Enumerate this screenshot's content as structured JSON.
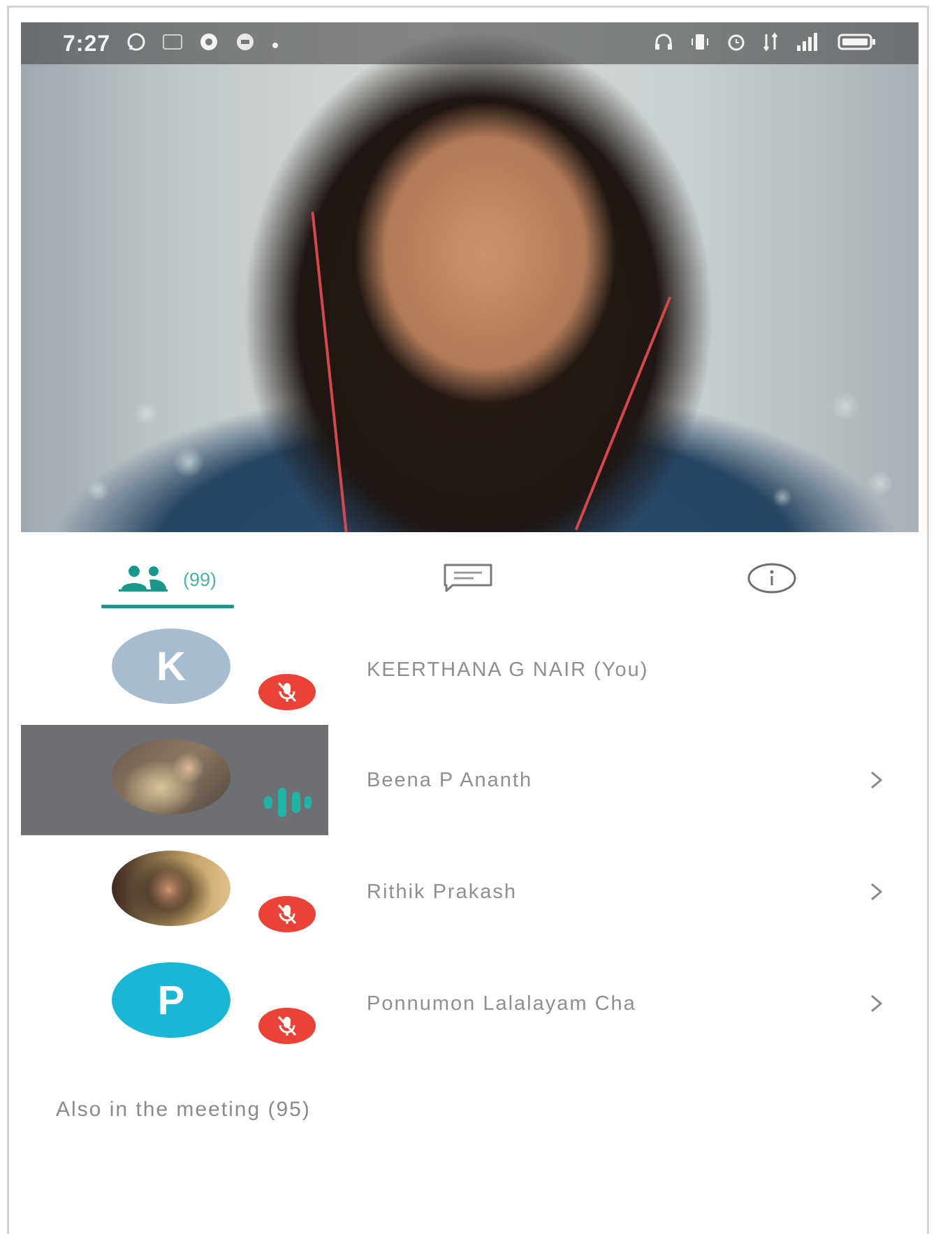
{
  "status_bar": {
    "time": "7:27",
    "left_icons": [
      "whatsapp-icon",
      "notification-icon",
      "record-icon",
      "app-icon",
      "dot-icon"
    ],
    "right_icons": [
      "headset-icon",
      "vibrate-icon",
      "alarm-icon",
      "data-icon",
      "signal-icon",
      "battery-icon"
    ]
  },
  "tabs": {
    "people_count": "(99)",
    "active": "people"
  },
  "colors": {
    "accent": "#17988a",
    "muted_badge": "#ea4335",
    "speaking": "#1fb5a5",
    "avatar_k": "#a7bccf",
    "avatar_p": "#19b7d5"
  },
  "participants": [
    {
      "initial": "K",
      "name": "KEERTHANA G NAIR (You)",
      "mic": "muted",
      "avatar": "initial"
    },
    {
      "initial": "",
      "name": "Beena P Ananth",
      "mic": "speaking",
      "avatar": "photo"
    },
    {
      "initial": "",
      "name": "Rithik Prakash",
      "mic": "muted",
      "avatar": "photo"
    },
    {
      "initial": "P",
      "name": "Ponnumon Lalalayam Cha",
      "mic": "muted",
      "avatar": "initial"
    }
  ],
  "also_in_meeting": "Also in the meeting (95)"
}
